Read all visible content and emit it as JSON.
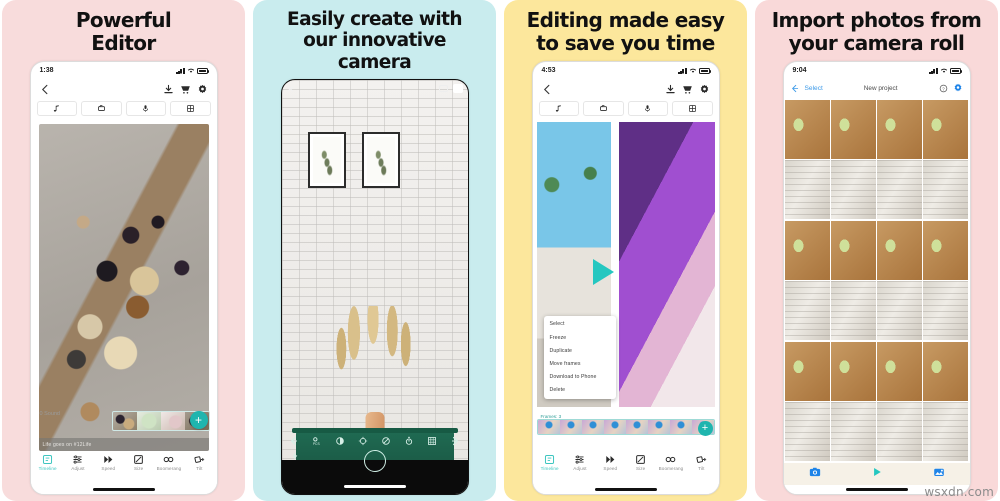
{
  "watermark": "wsxdn.com",
  "panels": [
    {
      "id": "panel-powerful-editor",
      "headline": "Powerful\nEditor",
      "bg": "#f8dcdc",
      "phone": {
        "status_time": "1:38",
        "nav_icons": [
          "back-chevron-icon",
          "download-icon",
          "cart-icon",
          "gear-icon"
        ],
        "tool_chips": [
          "music-note-icon",
          "crop-icon",
          "microphone-icon",
          "grid-icon"
        ],
        "caption": "Life goes on #12Life",
        "sound_label": "0 Sound",
        "add_button": "+",
        "tabs": [
          {
            "label": "Timeline",
            "icon": "timeline-icon",
            "active": true
          },
          {
            "label": "Adjust",
            "icon": "adjust-icon",
            "active": false
          },
          {
            "label": "Speed",
            "icon": "speed-icon",
            "active": false
          },
          {
            "label": "Size",
            "icon": "size-icon",
            "active": false
          },
          {
            "label": "Boomerang",
            "icon": "boomerang-icon",
            "active": false
          },
          {
            "label": "Tilt",
            "icon": "tilt-icon",
            "active": false
          }
        ]
      }
    },
    {
      "id": "panel-innovative-camera",
      "headline": "Easily create with\nour innovative\ncamera",
      "bg": "#c9ecee",
      "phone": {
        "close_label": "✕",
        "camera_controls": [
          "prev-arrow-icon",
          "pcs-label-icon",
          "contrast-icon",
          "exposure-icon",
          "no-flash-icon",
          "timer-icon",
          "grid-icon",
          "next-arrow-icon"
        ],
        "flash_icon": "flash-icon",
        "shutter": "shutter-button"
      }
    },
    {
      "id": "panel-editing-made-easy",
      "headline": "Editing made easy\nto save you time",
      "bg": "#fce79c",
      "phone": {
        "status_time": "4:53",
        "nav_icons": [
          "back-chevron-icon",
          "download-icon",
          "cart-icon",
          "gear-icon"
        ],
        "tool_chips": [
          "music-note-icon",
          "crop-icon",
          "microphone-icon",
          "grid-icon"
        ],
        "context_menu": [
          "Select",
          "Freeze",
          "Duplicate",
          "Move frames",
          "Download to Phone",
          "Delete"
        ],
        "frames_label": "Frames: 3",
        "add_button": "+",
        "tabs": [
          {
            "label": "Timeline",
            "icon": "timeline-icon",
            "active": true
          },
          {
            "label": "Adjust",
            "icon": "adjust-icon",
            "active": false
          },
          {
            "label": "Speed",
            "icon": "speed-icon",
            "active": false
          },
          {
            "label": "Size",
            "icon": "size-icon",
            "active": false
          },
          {
            "label": "Boomerang",
            "icon": "boomerang-icon",
            "active": false
          },
          {
            "label": "Tilt",
            "icon": "tilt-icon",
            "active": false
          }
        ]
      }
    },
    {
      "id": "panel-import-photos",
      "headline": "Import photos from\nyour camera roll",
      "bg": "#f9d9d9",
      "phone": {
        "status_time": "9:04",
        "back_icon": "back-arrow-icon",
        "select_label": "Select",
        "title": "New project",
        "help_icon": "help-circle-icon",
        "settings_icon": "gear-icon",
        "accent": "#3c9ae8",
        "bottom_nav": [
          "camera-icon",
          "play-icon",
          "photo-library-icon"
        ]
      }
    }
  ]
}
